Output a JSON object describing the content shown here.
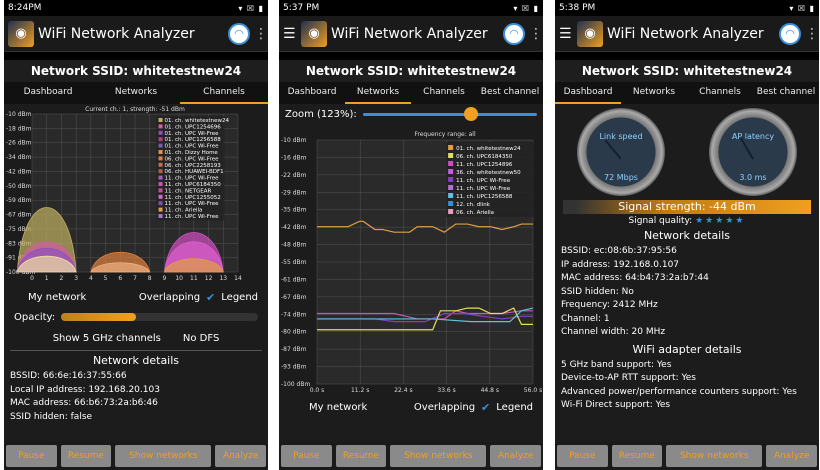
{
  "app": {
    "title": "WiFi Network Analyzer"
  },
  "buttons": {
    "pause": "Pause",
    "resume": "Resume",
    "show_networks": "Show networks",
    "analyze": "Analyze"
  },
  "screen1": {
    "status_time": "8:24PM",
    "ssid_title": "Network SSID: whitetestnew24",
    "tabs": [
      "Dashboard",
      "Networks",
      "Channels"
    ],
    "active_tab": "Channels",
    "chart_header": "Current ch.: 1, strength: -51 dBm",
    "options": {
      "my_network": "My network",
      "overlapping": "Overlapping",
      "legend": "Legend"
    },
    "opacity_label": "Opacity:",
    "opacity_value": 0.38,
    "show5": "Show 5 GHz channels",
    "nodfs": "No DFS",
    "network_details": "Network details",
    "details": [
      "BSSID: 66:6e:16:37:55:66",
      "Local IP address: 192.168.20.103",
      "MAC address: 66:b6:73:2a:b6:46",
      "SSID hidden: false"
    ]
  },
  "screen2": {
    "status_time": "5:37 PM",
    "ssid_title": "Network SSID: whitetestnew24",
    "tabs": [
      "Dashboard",
      "Networks",
      "Channels",
      "Best channel"
    ],
    "active_tab": "Networks",
    "zoom_label": "Zoom (123%):",
    "zoom_value": 0.62,
    "freq_label": "Frequency range: all",
    "options": {
      "my_network": "My network",
      "overlapping": "Overlapping",
      "legend": "Legend"
    }
  },
  "screen3": {
    "status_time": "5:38 PM",
    "ssid_title": "Network SSID: whitetestnew24",
    "tabs": [
      "Dashboard",
      "Networks",
      "Channels",
      "Best channel"
    ],
    "active_tab": "Dashboard",
    "gauge1": {
      "label": "Link speed",
      "value": "72 Mbps"
    },
    "gauge2": {
      "label": "AP latency",
      "value": "3.0 ms"
    },
    "signal_strength": "Signal strength: -44 dBm",
    "signal_quality": "Signal quality:",
    "stars": "★★★★★",
    "network_details": "Network details",
    "details": [
      "BSSID: ec:08:6b:37:95:56",
      "IP address: 192.168.0.107",
      "MAC address: 64:b4:73:2a:b7:44",
      "SSID hidden: No",
      "Frequency: 2412 MHz",
      "Channel: 1",
      "Channel width: 20 MHz"
    ],
    "adapter_title": "WiFi adapter details",
    "adapter": [
      "5 GHz band support: Yes",
      "Device-to-AP RTT support: Yes",
      "Advanced power/performance counters support: Yes",
      "Wi-Fi Direct support: Yes"
    ]
  },
  "chart_data": [
    {
      "type": "area",
      "title": "Current ch.: 1, strength: -51 dBm",
      "y_ticks": [
        "-10 dBm",
        "-18 dBm",
        "-26 dBm",
        "-34 dBm",
        "-42 dBm",
        "-50 dBm",
        "-59 dBm",
        "-67 dBm",
        "-75 dBm",
        "-83 dBm",
        "-91 dBm",
        "-100 dBm"
      ],
      "x_ticks": [
        "0",
        "1",
        "2",
        "3",
        "4",
        "5",
        "6",
        "7",
        "8",
        "9",
        "10",
        "11",
        "12",
        "13",
        "14"
      ],
      "ylim": [
        -100,
        -10
      ],
      "xlim": [
        0,
        14
      ],
      "legend": [
        {
          "name": "01. ch. whitetestnew24",
          "color": "#c0b060"
        },
        {
          "name": "01. ch. UPC1254696",
          "color": "#d060a0"
        },
        {
          "name": "01. ch. UPC Wi-Free",
          "color": "#9050c0"
        },
        {
          "name": "01. ch. UPC1256588",
          "color": "#b04080"
        },
        {
          "name": "01. ch. UPC Wi-Free",
          "color": "#7060b0"
        },
        {
          "name": "01. ch. Dizzy Home",
          "color": "#e09050"
        },
        {
          "name": "06. ch. UPC Wi-Free",
          "color": "#e08040"
        },
        {
          "name": "06. ch. UPC2258193",
          "color": "#c07050"
        },
        {
          "name": "06. ch. HUAWEI-BDF1",
          "color": "#b06040"
        },
        {
          "name": "11. ch. UPC Wi-Free",
          "color": "#a060c0"
        },
        {
          "name": "11. ch. UPC6184350",
          "color": "#d050c0"
        },
        {
          "name": "11. ch. NETGEAR",
          "color": "#c050a0"
        },
        {
          "name": "11. ch. UPC1255052",
          "color": "#e060d0"
        },
        {
          "name": "11. ch. UPC Wi-Free",
          "color": "#8050b0"
        },
        {
          "name": "11. ch. Ariella",
          "color": "#e0a040"
        },
        {
          "name": "11. ch. UPC Wi-Free",
          "color": "#b070d0"
        }
      ],
      "series": [
        {
          "name": "01. ch. whitetestnew24",
          "center": 1,
          "values": [
            -51
          ],
          "color": "#c0b060"
        },
        {
          "name": "01. ch. UPC1254696",
          "center": 1,
          "values": [
            -77
          ],
          "color": "#d060a0"
        },
        {
          "name": "01. ch. UPC Wi-Free",
          "center": 1,
          "values": [
            -82
          ],
          "color": "#9050c0"
        },
        {
          "name": "01. ch. UPC1256588",
          "center": 1,
          "values": [
            -88
          ],
          "color": "#f0e0a0"
        },
        {
          "name": "06. ch. UPC Wi-Free",
          "center": 6,
          "values": [
            -85
          ],
          "color": "#e08040"
        },
        {
          "name": "06. ch. UPC2258193",
          "center": 6,
          "values": [
            -93
          ],
          "color": "#f0b080"
        },
        {
          "name": "11. ch. UPC6184350",
          "center": 11,
          "values": [
            -70
          ],
          "color": "#d050c0"
        },
        {
          "name": "11. ch. UPC1255052",
          "center": 11,
          "values": [
            -77
          ],
          "color": "#e060d0"
        },
        {
          "name": "11. ch. Ariella",
          "center": 11,
          "values": [
            -90
          ],
          "color": "#e0a040"
        }
      ]
    },
    {
      "type": "line",
      "title": "Frequency range: all",
      "y_ticks": [
        "-10 dBm",
        "-16 dBm",
        "-22 dBm",
        "-29 dBm",
        "-35 dBm",
        "-42 dBm",
        "-48 dBm",
        "-55 dBm",
        "-61 dBm",
        "-67 dBm",
        "-74 dBm",
        "-80 dBm",
        "-87 dBm",
        "-93 dBm",
        "-100 dBm"
      ],
      "x_ticks": [
        "0.0 s",
        "11.2 s",
        "22.4 s",
        "33.6 s",
        "44.8 s",
        "56.0 s"
      ],
      "ylim": [
        -100,
        -10
      ],
      "xlim": [
        0,
        56
      ],
      "legend": [
        {
          "name": "01. ch. whitetestnew24",
          "color": "#e0a040"
        },
        {
          "name": "06. ch. UPC6184350",
          "color": "#e0e060"
        },
        {
          "name": "11. ch. UPC1254896",
          "color": "#d050c0"
        },
        {
          "name": "36. ch. whitetestnew50",
          "color": "#c060e0"
        },
        {
          "name": "11. ch. UPC Wi-Free",
          "color": "#8040c0"
        },
        {
          "name": "11. ch. UPC Wi-Free",
          "color": "#b070d0"
        },
        {
          "name": "11. ch. UPC1256588",
          "color": "#60c0e0"
        },
        {
          "name": "12. ch. dlink",
          "color": "#3a8fd8"
        },
        {
          "name": "06. ch. Ariella",
          "color": "#e0a0c0"
        }
      ],
      "series": [
        {
          "name": "01. ch. whitetestnew24",
          "color": "#e0a040",
          "x": [
            0,
            8,
            11,
            12,
            15,
            17,
            20,
            24,
            26,
            30,
            33,
            36,
            39,
            42,
            45,
            48,
            51,
            53,
            56
          ],
          "values": [
            -42,
            -42,
            -40,
            -40,
            -43,
            -43,
            -44,
            -44,
            -42,
            -42,
            -44,
            -41,
            -41,
            -42,
            -42,
            -43,
            -42,
            -41,
            -41
          ]
        },
        {
          "name": "11. ch. UPC1254896",
          "color": "#d050c0",
          "x": [
            0,
            10,
            20,
            26,
            30,
            33,
            36,
            39,
            42,
            48,
            53,
            56
          ],
          "values": [
            -74,
            -74,
            -74,
            -76,
            -76,
            -76,
            -73,
            -74,
            -74,
            -74,
            -73,
            -73
          ]
        },
        {
          "name": "11. ch. UPC Wi-Free",
          "color": "#8040c0",
          "x": [
            0,
            5,
            10,
            15,
            20,
            28,
            33,
            38,
            43,
            48,
            53,
            56
          ],
          "values": [
            -76,
            -76,
            -76,
            -76,
            -77,
            -77,
            -74,
            -74,
            -75,
            -76,
            -75,
            -75
          ]
        },
        {
          "name": "06. ch. UPC6184350",
          "color": "#e0e060",
          "x": [
            0,
            30,
            32,
            36,
            39,
            42,
            45,
            48,
            51,
            53,
            56
          ],
          "values": [
            -80,
            -80,
            -73,
            -73,
            -72,
            -72,
            -74,
            -74,
            -72,
            -78,
            -78
          ]
        },
        {
          "name": "11. ch. UPC1256588",
          "color": "#60c0e0",
          "x": [
            0,
            10,
            20,
            30,
            40,
            50,
            53,
            56
          ],
          "values": [
            -76,
            -76,
            -76,
            -76,
            -77,
            -77,
            -73,
            -72
          ]
        }
      ]
    }
  ]
}
